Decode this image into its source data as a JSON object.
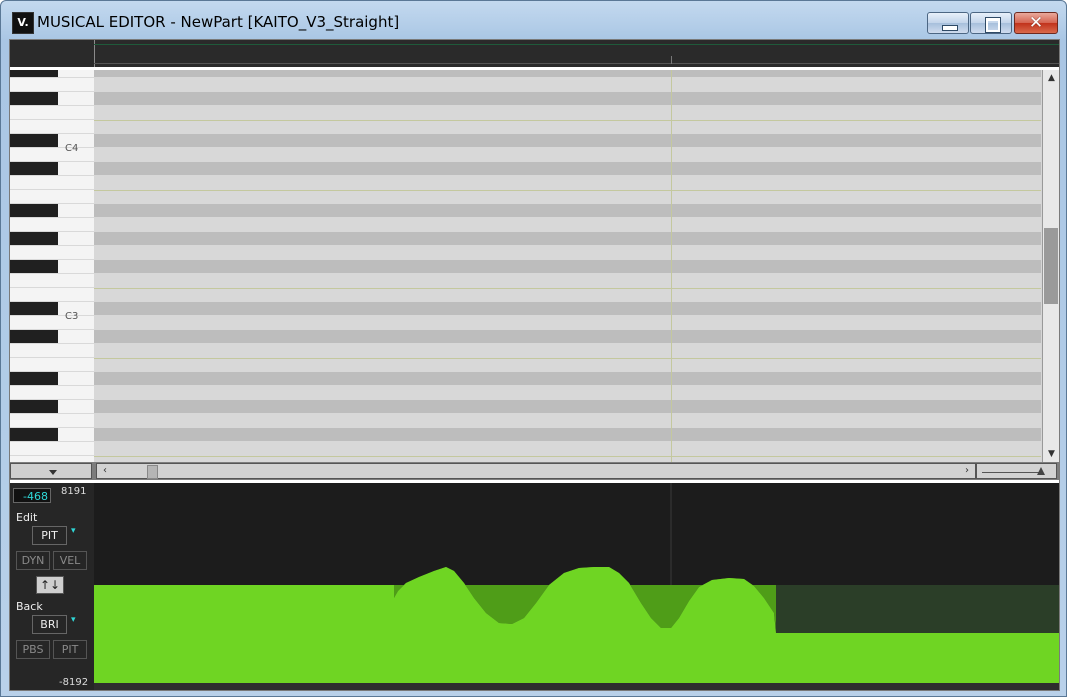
{
  "window": {
    "icon_text": "V.",
    "title": "MUSICAL EDITOR - NewPart [KAITO_V3_Straight]",
    "buttons": [
      "minimize-icon",
      "maximize-icon",
      "close-icon"
    ]
  },
  "piano_roll": {
    "note_labels": [
      "C4",
      "C3"
    ]
  },
  "control_panel": {
    "value": "-468",
    "max_label": "8191",
    "min_label": "-8192",
    "edit_label": "Edit",
    "edit_param": "PIT",
    "edit_buttons": [
      "DYN",
      "VEL"
    ],
    "updown_label": "↑↓",
    "back_label": "Back",
    "back_param": "BRI",
    "back_buttons": [
      "PBS",
      "PIT"
    ],
    "dropdown_icon": "▾"
  },
  "scroll": {
    "left_arrow": "‹",
    "right_arrow": "›",
    "up_arrow": "▲",
    "down_arrow": "▼"
  },
  "colors": {
    "curve_edit": "#6fd523",
    "curve_edit_dark": "#4f9d18",
    "curve_back": "#2b3e28",
    "ctrl_bg": "#1c1c1c"
  }
}
